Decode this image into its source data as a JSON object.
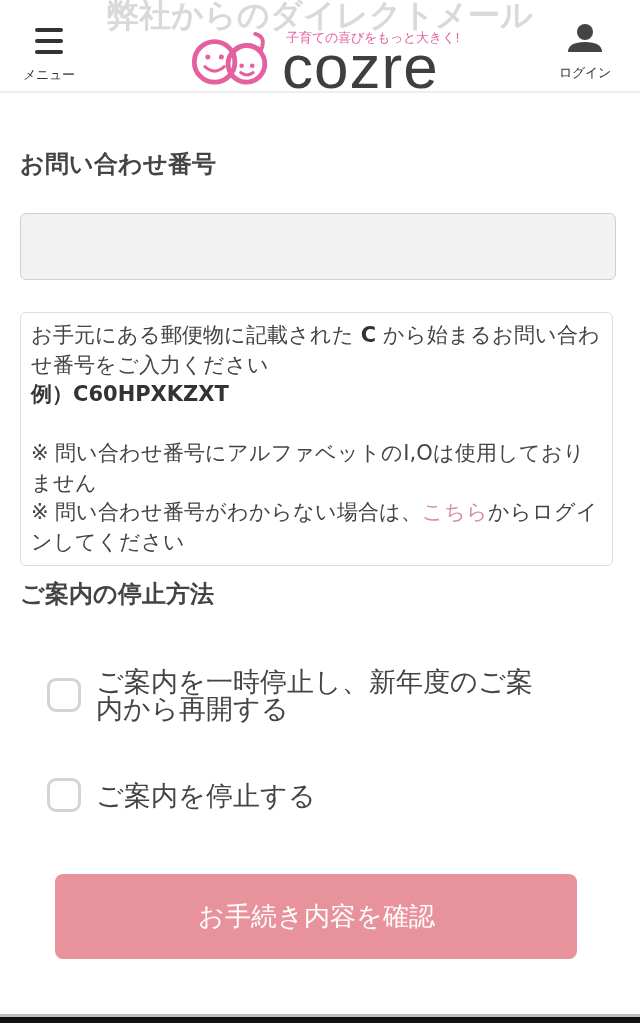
{
  "background_title": {
    "text": "弊社からのダイレクトメール"
  },
  "header": {
    "menu_button": {
      "label": "メニュー"
    },
    "logo": {
      "tagline": "子育ての喜びをもっと大きく!",
      "wordmark": "cozre"
    },
    "login_button": {
      "label": "ログイン"
    }
  },
  "inquiry": {
    "heading": "お問い合わせ番号"
  },
  "notice": {
    "intro": "お手元にある郵便物に記載された **C** から始まるお問い合わせ番号をご入力ください",
    "example": "例）C60HPXKZXT",
    "notes": [
      {
        "kind": "text",
        "text": "※ 問い合わせ番号にアルファベットのI,Oは使用しておりません"
      },
      {
        "kind": "link",
        "before": "※ 問い合わせ番号がわからない場合は、",
        "link": "こちら",
        "after": "からログインしてください"
      }
    ]
  },
  "stop_method": {
    "heading": "ご案内の停止方法",
    "options": [
      {
        "label": "ご案内を一時停止し、新年度のご案内から再開する",
        "checked": false
      },
      {
        "label": "ご案内を停止する",
        "checked": false
      }
    ]
  },
  "confirm_button": {
    "label": "お手続き内容を確認"
  }
}
